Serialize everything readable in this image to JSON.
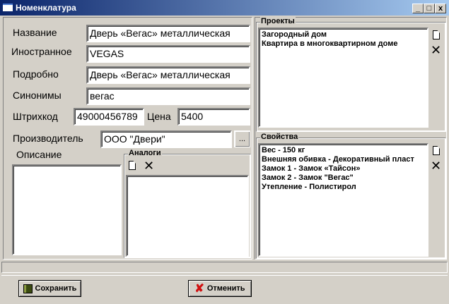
{
  "window": {
    "title": "Номенклатура",
    "minimize": "_",
    "maximize": "□",
    "close": "x"
  },
  "form": {
    "name_label": "Название",
    "name_value": "Дверь «Вегас» металлическая",
    "foreign_label": "Иностранное",
    "foreign_value": "VEGAS",
    "detail_label": "Подробно",
    "detail_value": "Дверь «Вегас» металлическая",
    "synonyms_label": "Синонимы",
    "synonyms_value": "вегас",
    "barcode_label": "Штрихкод",
    "barcode_value": "49000456789",
    "price_label": "Цена",
    "price_value": "5400",
    "maker_label": "Производитель",
    "maker_value": "ООО \"Двери\"",
    "maker_browse": "...",
    "description_label": "Описание",
    "description_value": ""
  },
  "analogs": {
    "title": "Аналоги",
    "items": []
  },
  "projects": {
    "title": "Проекты",
    "items": [
      "Загородный дом",
      "Квартира в многоквартирном доме"
    ]
  },
  "properties": {
    "title": "Свойства",
    "items": [
      "Вес - 150 кг",
      "Внешняя обивка - Декоративный пласт",
      "Замок 1 - Замок «Тайсон»",
      "Замок 2 - Замок \"Вегас\"",
      "Утепление - Полистирол"
    ]
  },
  "footer": {
    "save": "Сохранить",
    "cancel": "Отменить"
  },
  "icons": {
    "new": "new-document-icon",
    "delete": "delete-x-icon",
    "save": "floppy-disk-icon",
    "cancel": "red-x-icon"
  }
}
